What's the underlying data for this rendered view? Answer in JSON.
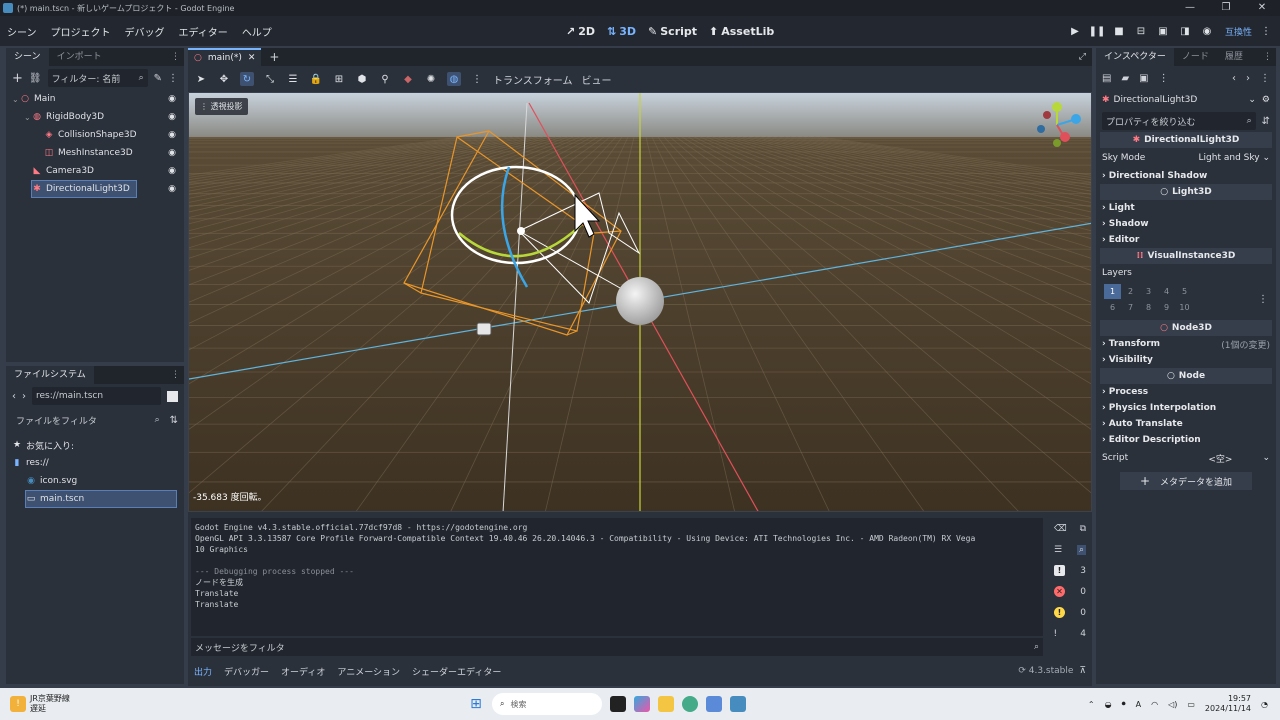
{
  "window": {
    "title": "(*) main.tscn - 新しいゲームプロジェクト - Godot Engine",
    "controls": [
      "—",
      "❐",
      "✕"
    ]
  },
  "menu": [
    "シーン",
    "プロジェクト",
    "デバッグ",
    "エディター",
    "ヘルプ"
  ],
  "main_tabs": [
    {
      "icon": "↗",
      "label": "2D"
    },
    {
      "icon": "⇅",
      "label": "3D"
    },
    {
      "icon": "✎",
      "label": "Script"
    },
    {
      "icon": "⬆",
      "label": "AssetLib"
    }
  ],
  "renderer": "互換性",
  "scene_dock": {
    "tabs": [
      "シーン",
      "インポート"
    ],
    "filter_placeholder": "フィルター: 名前",
    "nodes": [
      {
        "name": "Main",
        "depth": 0,
        "icon": "○",
        "color": "#ff7a85"
      },
      {
        "name": "RigidBody3D",
        "depth": 1,
        "icon": "◍",
        "color": "#ff7a85"
      },
      {
        "name": "CollisionShape3D",
        "depth": 2,
        "icon": "◈",
        "color": "#ff7a85"
      },
      {
        "name": "MeshInstance3D",
        "depth": 2,
        "icon": "◫",
        "color": "#ff7a85"
      },
      {
        "name": "Camera3D",
        "depth": 1,
        "icon": "◣",
        "color": "#ff7a85"
      },
      {
        "name": "DirectionalLight3D",
        "depth": 1,
        "icon": "✱",
        "color": "#ff7a85",
        "selected": true
      }
    ]
  },
  "filesystem": {
    "tab": "ファイルシステム",
    "path": "res://main.tscn",
    "filter_placeholder": "ファイルをフィルタ",
    "items": [
      {
        "name": "お気に入り:",
        "depth": 0,
        "icon": "★"
      },
      {
        "name": "res://",
        "depth": 0,
        "icon": "▮"
      },
      {
        "name": "icon.svg",
        "depth": 1,
        "icon": "◉"
      },
      {
        "name": "main.tscn",
        "depth": 1,
        "icon": "▭",
        "selected": true
      }
    ]
  },
  "viewport": {
    "tab_label": "main(*)",
    "toolbar_labels": [
      "トランスフォーム",
      "ビュー"
    ],
    "perspective": "透視投影",
    "rotation_readout": "-35.683 度回転。"
  },
  "output": {
    "lines": [
      "Godot Engine v4.3.stable.official.77dcf97d8 - https://godotengine.org",
      "OpenGL API 3.3.13587 Core Profile Forward-Compatible Context 19.40.46 26.20.14046.3 - Compatibility - Using Device: ATI Technologies Inc. - AMD Radeon(TM) RX Vega",
      "10 Graphics",
      "",
      "--- Debugging process stopped ---",
      "ノードを生成",
      "Translate",
      "Translate"
    ],
    "counts": {
      "messages": "3",
      "errors": "0",
      "warnings": "0",
      "info": "4"
    },
    "filter_placeholder": "メッセージをフィルタ",
    "bottom_tabs": [
      "出力",
      "デバッガー",
      "オーディオ",
      "アニメーション",
      "シェーダーエディター"
    ],
    "version": "4.3.stable"
  },
  "inspector": {
    "tabs": [
      "インスペクター",
      "ノード",
      "履歴"
    ],
    "object": "DirectionalLight3D",
    "filter_placeholder": "プロパティを絞り込む",
    "header_main": "DirectionalLight3D",
    "sky_mode_label": "Sky Mode",
    "sky_mode_value": "Light and Sky",
    "directional_shadow": "Directional Shadow",
    "header_light": "Light3D",
    "light_sections": [
      "Light",
      "Shadow",
      "Editor"
    ],
    "header_visual": "VisualInstance3D",
    "layers_label": "Layers",
    "layers": [
      "1",
      "2",
      "3",
      "4",
      "5",
      "6",
      "7",
      "8",
      "9",
      "10"
    ],
    "header_node3d": "Node3D",
    "transform": "Transform",
    "transform_note": "(1個の変更)",
    "visibility": "Visibility",
    "header_node": "Node",
    "node_sections": [
      "Process",
      "Physics Interpolation",
      "Auto Translate",
      "Editor Description"
    ],
    "script_label": "Script",
    "script_value": "<空>",
    "add_metadata": "メタデータを追加"
  },
  "taskbar": {
    "weather_line1": "JR京葉野線",
    "weather_line2": "遅延",
    "search": "検索",
    "time": "19:57",
    "date": "2024/11/14"
  }
}
